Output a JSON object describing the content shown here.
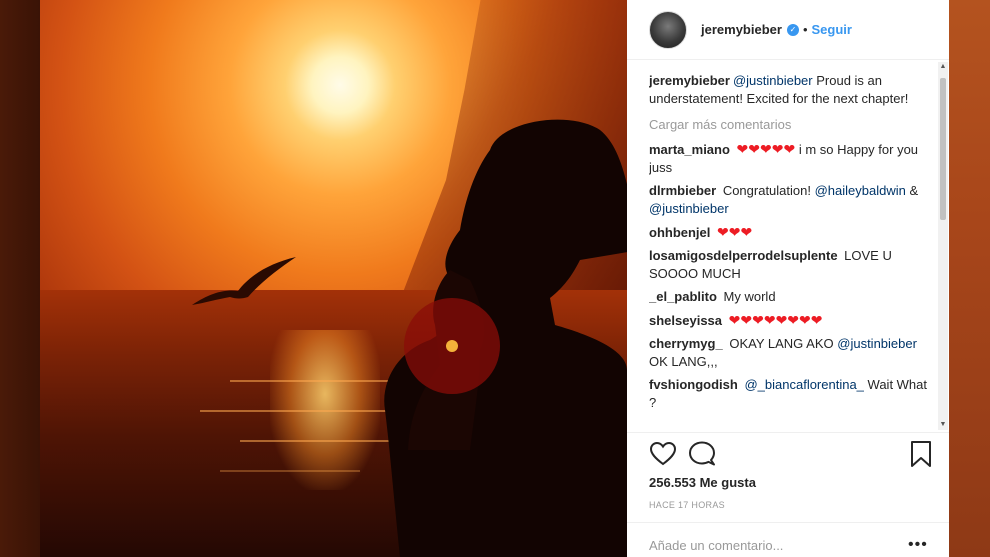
{
  "post": {
    "username": "jeremybieber",
    "verified_icon": "verified-badge-icon",
    "separator": "•",
    "follow_label": "Seguir"
  },
  "caption": {
    "user": "jeremybieber",
    "mention": "@justinbieber",
    "text": " Proud is an understatement! Excited for the next chapter!"
  },
  "load_more": "Cargar más comentarios",
  "comments": [
    {
      "user": "marta_miano",
      "hearts": "❤❤❤❤❤",
      "text": " i m so Happy for you juss"
    },
    {
      "user": "dlrmbieber",
      "text1": "Congratulation! ",
      "mention1": "@haileybaldwin",
      "text2": " & ",
      "mention2": "@justinbieber"
    },
    {
      "user": "ohhbenjel",
      "hearts": "❤❤❤"
    },
    {
      "user": "losamigosdelperrodelsuplente",
      "text": "LOVE U SOOOO MUCH"
    },
    {
      "user": "_el_pablito",
      "text": "My world"
    },
    {
      "user": "shelseyissa",
      "hearts": "❤❤❤❤❤❤❤❤"
    },
    {
      "user": "cherrymyg_",
      "text1": "OKAY LANG AKO ",
      "mention": "@justinbieber",
      "text2": " OK LANG,,,"
    },
    {
      "user": "fvshiongodish",
      "mention": "@_biancaflorentina_",
      "text": " Wait What ?"
    }
  ],
  "actions": {
    "like_icon": "heart-outline-icon",
    "comment_icon": "comment-bubble-icon",
    "save_icon": "bookmark-icon"
  },
  "likes": "256.553 Me gusta",
  "timestamp": "HACE 17 HORAS",
  "add_comment_placeholder": "Añade un comentario...",
  "more_options": "•••",
  "colors": {
    "link_blue": "#3897f0",
    "mention_blue": "#003569",
    "muted": "#999999",
    "heart_red": "#ed1c24"
  }
}
